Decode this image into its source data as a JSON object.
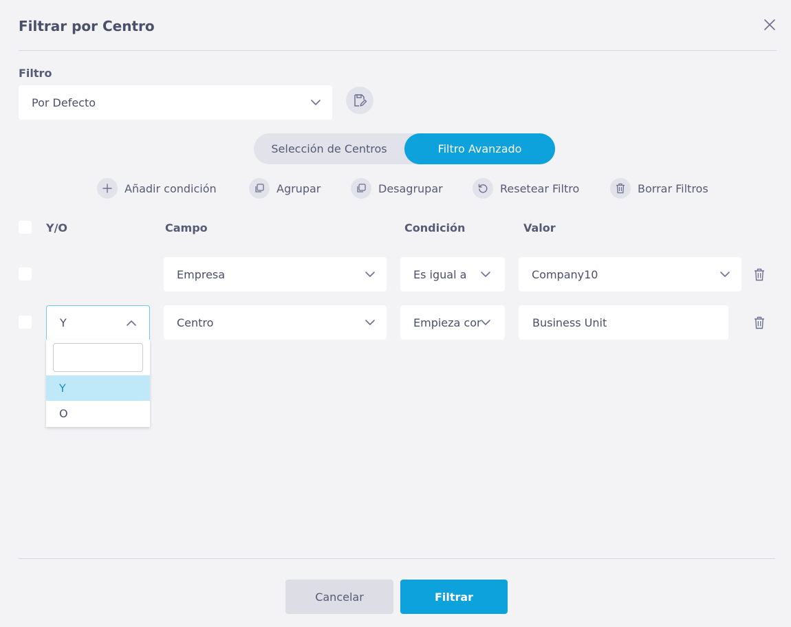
{
  "dialog": {
    "title": "Filtrar por Centro"
  },
  "filter": {
    "label": "Filtro",
    "selected": "Por Defecto"
  },
  "mode_toggle": {
    "left_label": "Selección de Centros",
    "right_label": "Filtro Avanzado",
    "active": "Filtro Avanzado"
  },
  "actions": [
    {
      "label": "Añadir condición",
      "icon": "plus-icon"
    },
    {
      "label": "Agrupar",
      "icon": "group-icon"
    },
    {
      "label": "Desagrupar",
      "icon": "ungroup-icon"
    },
    {
      "label": "Resetear Filtro",
      "icon": "reset-icon"
    },
    {
      "label": "Borrar Filtros",
      "icon": "trash-icon"
    }
  ],
  "table": {
    "headers": {
      "andor": "Y/O",
      "field": "Campo",
      "condition": "Condición",
      "value": "Valor"
    },
    "rows": [
      {
        "andor": "",
        "field": "Empresa",
        "condition": "Es igual a",
        "value": "Company10"
      },
      {
        "andor": "Y",
        "field": "Centro",
        "condition": "Empieza con",
        "value": "Business Unit"
      }
    ]
  },
  "andor_dropdown": {
    "search_value": "",
    "options": [
      "Y",
      "O"
    ],
    "selected": "Y"
  },
  "footer": {
    "cancel_label": "Cancelar",
    "submit_label": "Filtrar"
  },
  "colors": {
    "primary": "#0da2dc",
    "background": "#f3f3f6",
    "text": "#4a4f6a",
    "selected_option_bg": "#bfe8f8"
  }
}
